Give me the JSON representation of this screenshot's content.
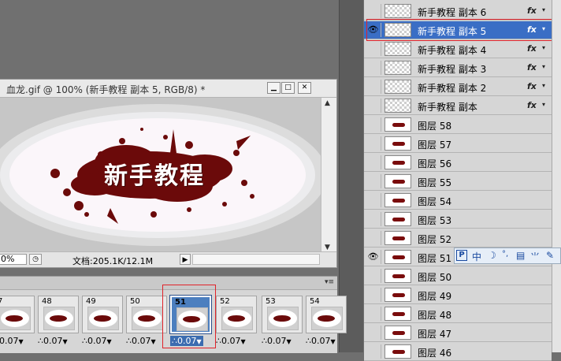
{
  "document": {
    "title": "血龙.gif @ 100% (新手教程 副本 5, RGB/8) *",
    "canvas_text": "新手教程",
    "zoom": "0%",
    "doc_info": "文档:205.1K/12.1M"
  },
  "animation": {
    "frames": [
      {
        "num": "7",
        "delay": "0.07"
      },
      {
        "num": "48",
        "delay": "0.07"
      },
      {
        "num": "49",
        "delay": "0.07"
      },
      {
        "num": "50",
        "delay": "0.07"
      },
      {
        "num": "51",
        "delay": "0.07"
      },
      {
        "num": "52",
        "delay": "0.07"
      },
      {
        "num": "53",
        "delay": "0.07"
      },
      {
        "num": "54",
        "delay": "0.07"
      }
    ]
  },
  "layers": [
    {
      "name": "新手教程 副本 6",
      "fx": "fx"
    },
    {
      "name": "新手教程 副本 5",
      "fx": "fx"
    },
    {
      "name": "新手教程 副本 4",
      "fx": "fx"
    },
    {
      "name": "新手教程 副本 3",
      "fx": "fx"
    },
    {
      "name": "新手教程 副本 2",
      "fx": "fx"
    },
    {
      "name": "新手教程 副本",
      "fx": "fx"
    },
    {
      "name": "图层 58"
    },
    {
      "name": "图层 57"
    },
    {
      "name": "图层 56"
    },
    {
      "name": "图层 55"
    },
    {
      "name": "图层 54"
    },
    {
      "name": "图层 53"
    },
    {
      "name": "图层 52"
    },
    {
      "name": "图层 51"
    },
    {
      "name": "图层 50"
    },
    {
      "name": "图层 49"
    },
    {
      "name": "图层 48"
    },
    {
      "name": "图层 47"
    },
    {
      "name": "图层 46"
    }
  ],
  "ime": {
    "logo": "P",
    "lang": "中"
  },
  "colors": {
    "selection": "#3a6ec5",
    "highlight_outline": "#e0232a",
    "blood": "#6b0a0a"
  }
}
